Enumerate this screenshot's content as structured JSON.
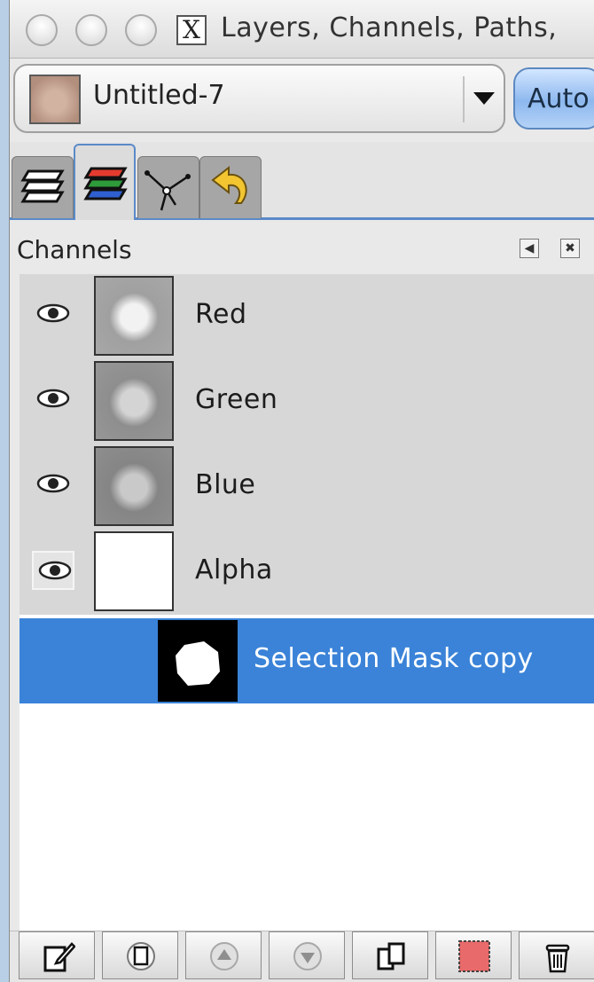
{
  "window": {
    "title": "Layers, Channels, Paths,"
  },
  "image_selector": {
    "value": "Untitled-7",
    "auto_label": "Auto"
  },
  "tabs": [
    {
      "icon": "layers-icon"
    },
    {
      "icon": "channels-icon",
      "active": true
    },
    {
      "icon": "paths-icon"
    },
    {
      "icon": "undo-history-icon"
    }
  ],
  "panel": {
    "title": "Channels"
  },
  "channels": [
    {
      "label": "Red",
      "visible": true
    },
    {
      "label": "Green",
      "visible": true
    },
    {
      "label": "Blue",
      "visible": true
    },
    {
      "label": "Alpha",
      "visible": true
    },
    {
      "label": "Selection Mask copy",
      "visible": false,
      "selected": true
    }
  ],
  "toolbar": [
    {
      "icon": "edit-channel-icon"
    },
    {
      "icon": "new-channel-icon"
    },
    {
      "icon": "raise-channel-icon"
    },
    {
      "icon": "lower-channel-icon"
    },
    {
      "icon": "duplicate-channel-icon"
    },
    {
      "icon": "channel-to-selection-icon"
    },
    {
      "icon": "delete-channel-icon"
    }
  ],
  "colors": {
    "selection": "#3a83d8",
    "tab_accent": "#5a8ac8",
    "row_bg": "#d7d7d7"
  }
}
